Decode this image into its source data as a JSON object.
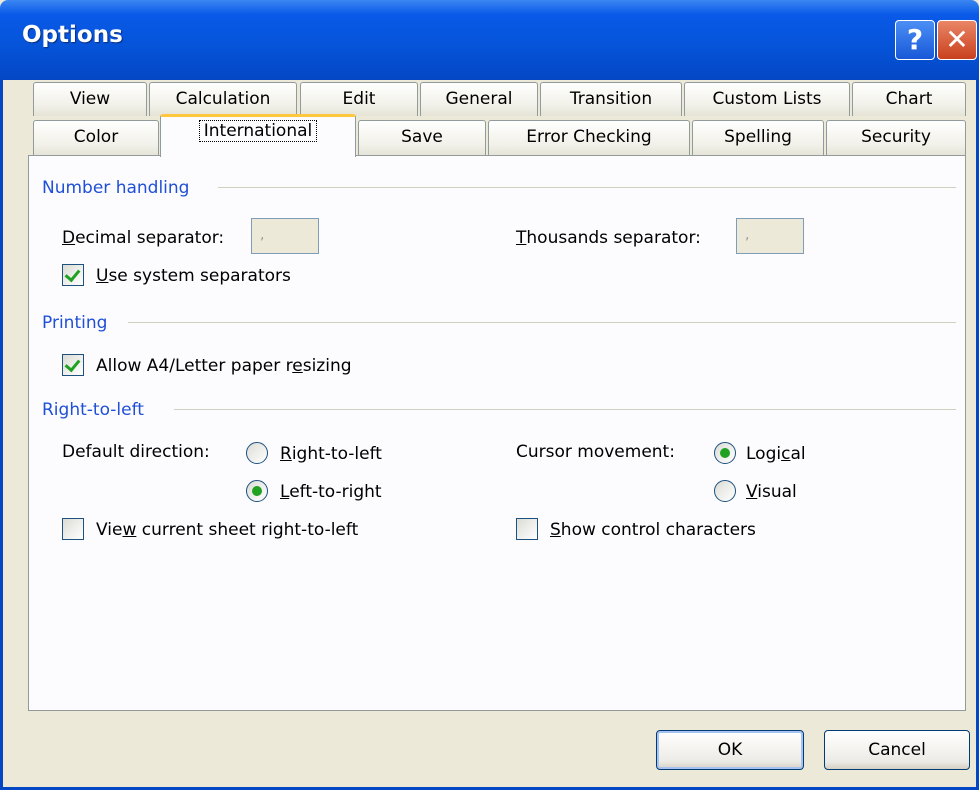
{
  "window": {
    "title": "Options",
    "help_glyph": "?",
    "close_glyph": "✕"
  },
  "tabs_row1": [
    "View",
    "Calculation",
    "Edit",
    "General",
    "Transition",
    "Custom Lists",
    "Chart"
  ],
  "tabs_row2": [
    "Color",
    "International",
    "Save",
    "Error Checking",
    "Spelling",
    "Security"
  ],
  "active_tab": "International",
  "number_handling": {
    "heading": "Number handling",
    "decimal_label_u": "D",
    "decimal_label_rest": "ecimal separator:",
    "decimal_value": ",",
    "thousands_label_u": "T",
    "thousands_label_rest": "housands separator:",
    "thousands_value": ",",
    "use_system_u": "U",
    "use_system_rest": "se system separators",
    "use_system_checked": true
  },
  "printing": {
    "heading": "Printing",
    "resize_pre": "Allow A4/Letter paper r",
    "resize_u": "e",
    "resize_post": "sizing",
    "resize_checked": true
  },
  "rtl": {
    "heading": "Right-to-left",
    "default_direction_label": "Default direction:",
    "rtl_u": "R",
    "rtl_rest": "ight-to-left",
    "ltr_u": "L",
    "ltr_rest": "eft-to-right",
    "direction_selected": "Left-to-right",
    "cursor_label": "Cursor movement:",
    "logical_pre": "Logi",
    "logical_u": "c",
    "logical_post": "al",
    "visual_u": "V",
    "visual_rest": "isual",
    "cursor_selected": "Logical",
    "view_sheet_pre": "Vie",
    "view_sheet_u": "w",
    "view_sheet_post": " current sheet right-to-left",
    "view_sheet_checked": false,
    "show_control_u": "S",
    "show_control_rest": "how control characters",
    "show_control_checked": false
  },
  "buttons": {
    "ok": "OK",
    "cancel": "Cancel"
  }
}
